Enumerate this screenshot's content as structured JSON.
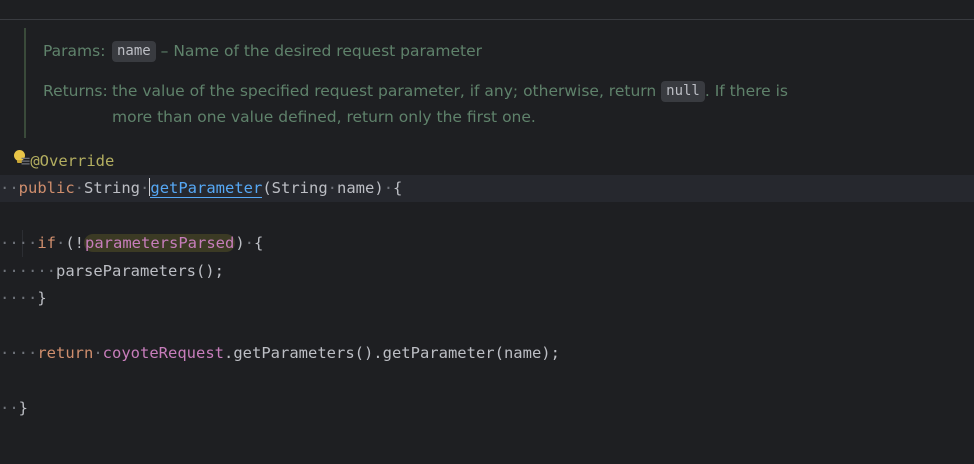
{
  "doc": {
    "params_label": "Params:",
    "param_name": "name",
    "param_desc": " – Name of the desired request parameter",
    "returns_label": "Returns:",
    "returns_text_1": "the value of the specified request parameter, if any; otherwise, return ",
    "returns_null": "null",
    "returns_text_2": ". If there is",
    "returns_text_3": "more than one value defined, return only the first one."
  },
  "code": {
    "annotation": "@Override",
    "kw_public": "public",
    "type_string": "String",
    "method_name": "getParameter",
    "signature_rest": "(String",
    "param_name": "name)",
    "open_brace": "{",
    "kw_if": "if",
    "if_paren": "(!",
    "field_parsed": "parametersParsed",
    "if_close": ")",
    "call_parse": "parseParameters();",
    "close_brace_inner": "}",
    "kw_return": "return",
    "field_coyote": "coyoteRequest",
    "return_rest": ".getParameters().getParameter(name);",
    "close_brace_outer": "}"
  },
  "icons": {
    "intention": "lightbulb-icon",
    "override": "override-gutter-icon"
  },
  "colors": {
    "background": "#1e1f22",
    "keyword": "#cf8e6d",
    "annotation": "#b3ae60",
    "method": "#56a8f5",
    "field": "#c77dbb",
    "doc_text": "#5f826b",
    "plain": "#bcbec4"
  }
}
